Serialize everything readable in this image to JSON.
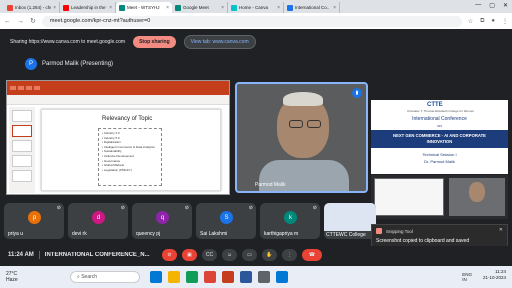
{
  "tabs": [
    {
      "title": "Inbox (1,284) - chu..",
      "color": "#ea4335"
    },
    {
      "title": "Leadership in the wo..",
      "color": "#ff0000"
    },
    {
      "title": "Meet - WTSYHJ",
      "color": "#00897b",
      "active": true
    },
    {
      "title": "Google Meet",
      "color": "#00897b"
    },
    {
      "title": "Home - Canva",
      "color": "#00c4cc"
    },
    {
      "title": "International Co..",
      "color": "#1a73e8"
    }
  ],
  "address": {
    "url": "meet.google.com/kpr-cnz-mt?authuser=0"
  },
  "sharebar": {
    "text": "Sharing https://www.canva.com to meet.google.com",
    "stop": "Stop sharing",
    "view": "View tab: www.canva.com"
  },
  "presenter": {
    "initial": "P",
    "label": "Parmod Malik (Presenting)"
  },
  "slide": {
    "title": "Relevancy of Topic",
    "bullets": [
      "• Industry 4.0",
      "• Industry 5.0",
      "• Digitalization",
      "• Intelligent Commerce & Data Analytics",
      "• Sustainability",
      "• Inclusive Development",
      "• Governance",
      "• Global Markets",
      "• Legislation (PMGKY)"
    ]
  },
  "video": {
    "name": "Parmod Malik"
  },
  "side": {
    "logo": "CTTE",
    "sub": "Chevalier T. Thomas Elizabeth College for Women",
    "conf": "International Conference",
    "on": "on",
    "theme1": "NEXT GEN COMMERCE - AI AND CORPORATE",
    "theme2": "INNOVATION",
    "session": "Technical Session I",
    "speaker": "Dr. Parmod Malik"
  },
  "participants": [
    {
      "initial": "p",
      "name": "priya u",
      "color": "#e8710a"
    },
    {
      "initial": "d",
      "name": "devi rk",
      "color": "#d01884"
    },
    {
      "initial": "q",
      "name": "queency pj",
      "color": "#8e24aa"
    },
    {
      "initial": "S",
      "name": "Sai Lakshmi",
      "color": "#1a73e8"
    },
    {
      "initial": "k",
      "name": "karthigapriya m",
      "color": "#00897b"
    }
  ],
  "cttewc": {
    "name": "CTTEWC College"
  },
  "snip": {
    "app": "Snipping Tool",
    "title": "Screenshot copied to clipboard and saved",
    "body": "Select here to mark up and share."
  },
  "call": {
    "time": "11:24 AM",
    "name": "INTERNATIONAL CONFERENCE_N..."
  },
  "taskbar": {
    "temp": "27°C",
    "cond": "Haze",
    "search": "Search",
    "lang1": "ENG",
    "lang2": "IN",
    "clock": "11:24",
    "date": "21-10-2024"
  }
}
